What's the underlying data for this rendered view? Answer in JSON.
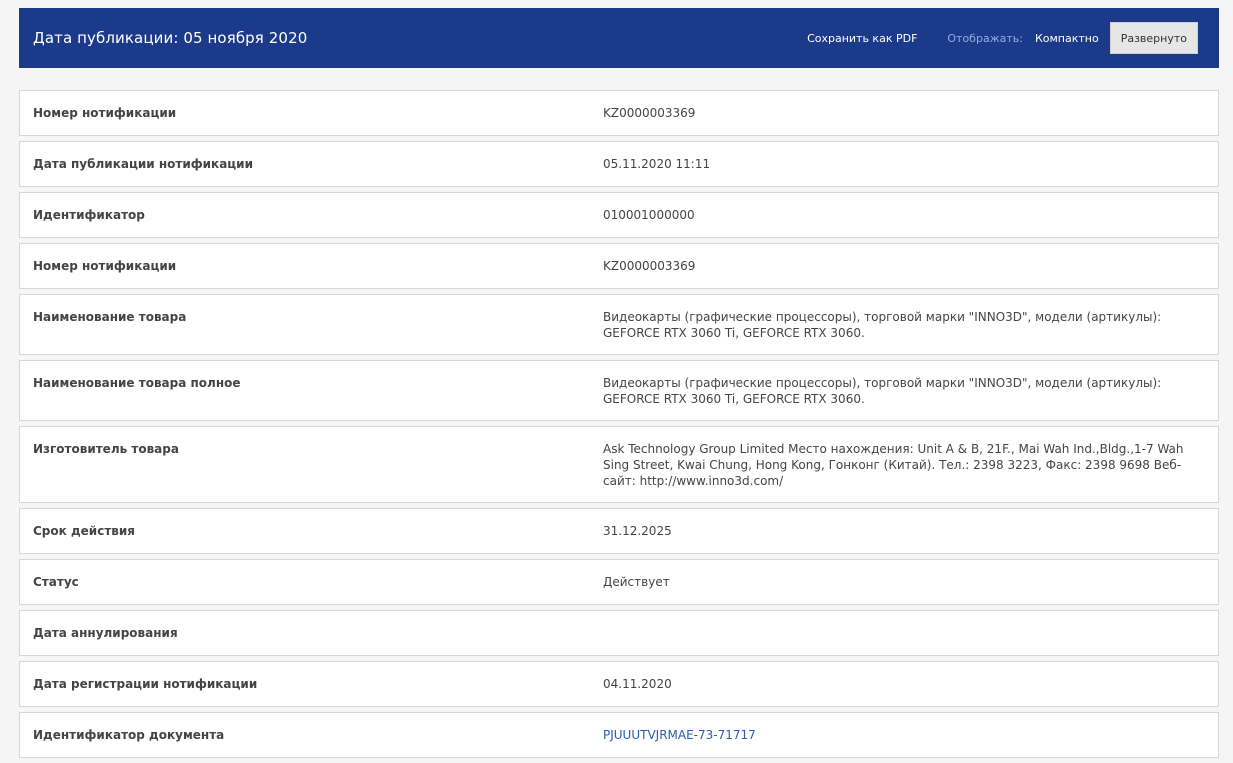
{
  "header": {
    "title": "Дата публикации: 05 ноября 2020",
    "pdf_label": "Сохранить как PDF",
    "display_label": "Отображать:",
    "compact_label": "Компактно",
    "expanded_label": "Развернуто"
  },
  "colors": {
    "header_bg": "#1c3a8a",
    "link": "#2a5db0"
  },
  "rows": [
    {
      "label": "Номер нотификации",
      "value": "KZ0000003369"
    },
    {
      "label": "Дата публикации нотификации",
      "value": "05.11.2020 11:11"
    },
    {
      "label": "Идентификатор",
      "value": "010001000000"
    },
    {
      "label": "Номер нотификации",
      "value": "KZ0000003369"
    },
    {
      "label": "Наименование товара",
      "value": "Видеокарты (графические процессоры), торговой марки \"INNO3D\", модели (артикулы): GEFORCE RTX 3060 Ti, GEFORCE RTX 3060."
    },
    {
      "label": "Наименование товара полное",
      "value": "Видеокарты (графические процессоры), торговой марки \"INNO3D\", модели (артикулы): GEFORCE RTX 3060 Ti, GEFORCE RTX 3060."
    },
    {
      "label": "Изготовитель товара",
      "value": "Ask Technology Group Limited Место нахождения: Unit A & B, 21F., Mai Wah Ind.,Bldg.,1-7 Wah Sing Street, Kwai Chung, Hong Kong, Гонконг (Китай). Тел.: 2398 3223, Факс: 2398 9698 Веб-сайт: http://www.inno3d.com/"
    },
    {
      "label": "Срок действия",
      "value": "31.12.2025"
    },
    {
      "label": "Статус",
      "value": "Действует"
    },
    {
      "label": "Дата аннулирования",
      "value": ""
    },
    {
      "label": "Дата регистрации нотификации",
      "value": "04.11.2020"
    },
    {
      "label": "Идентификатор документа",
      "value": "PJUUUTVJRMAE-73-71717"
    }
  ]
}
